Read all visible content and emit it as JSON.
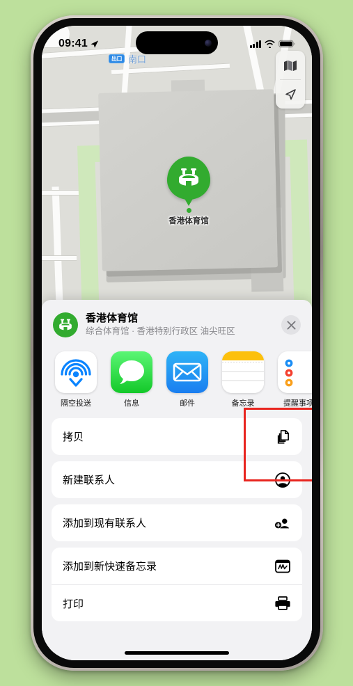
{
  "status_bar": {
    "time": "09:41",
    "location_icon": "location-arrow-icon",
    "cellular_icon": "cellular-bars-icon",
    "wifi_icon": "wifi-icon",
    "battery_icon": "battery-full-icon"
  },
  "map": {
    "exit_badge": "出口",
    "exit_label": "南口",
    "poi_label": "香港体育馆",
    "poi_icon": "stadium-icon",
    "controls": [
      {
        "name": "map-layers-icon",
        "label": "地图"
      },
      {
        "name": "locate-me-icon",
        "label": "定位"
      }
    ]
  },
  "share_sheet": {
    "poi_icon": "stadium-icon",
    "title": "香港体育馆",
    "subtitle": "综合体育馆 · 香港特别行政区 油尖旺区",
    "close_label": "关闭",
    "apps": [
      {
        "label": "隔空投送",
        "icon": "airdrop-icon"
      },
      {
        "label": "信息",
        "icon": "messages-icon"
      },
      {
        "label": "邮件",
        "icon": "mail-icon"
      },
      {
        "label": "备忘录",
        "icon": "notes-icon"
      },
      {
        "label": "提醒事项",
        "icon": "reminders-icon"
      }
    ],
    "actions": [
      [
        {
          "label": "拷贝",
          "icon": "copy-icon"
        }
      ],
      [
        {
          "label": "新建联系人",
          "icon": "person-circle-icon"
        }
      ],
      [
        {
          "label": "添加到现有联系人",
          "icon": "person-badge-plus-icon"
        }
      ],
      [
        {
          "label": "添加到新快速备忘录",
          "icon": "quick-note-icon"
        },
        {
          "label": "打印",
          "icon": "printer-icon"
        }
      ]
    ]
  },
  "colors": {
    "background": "#bde09c",
    "accent_green": "#32ab2f",
    "highlight_red": "#e8251f",
    "transit_blue": "#2d89e5"
  }
}
